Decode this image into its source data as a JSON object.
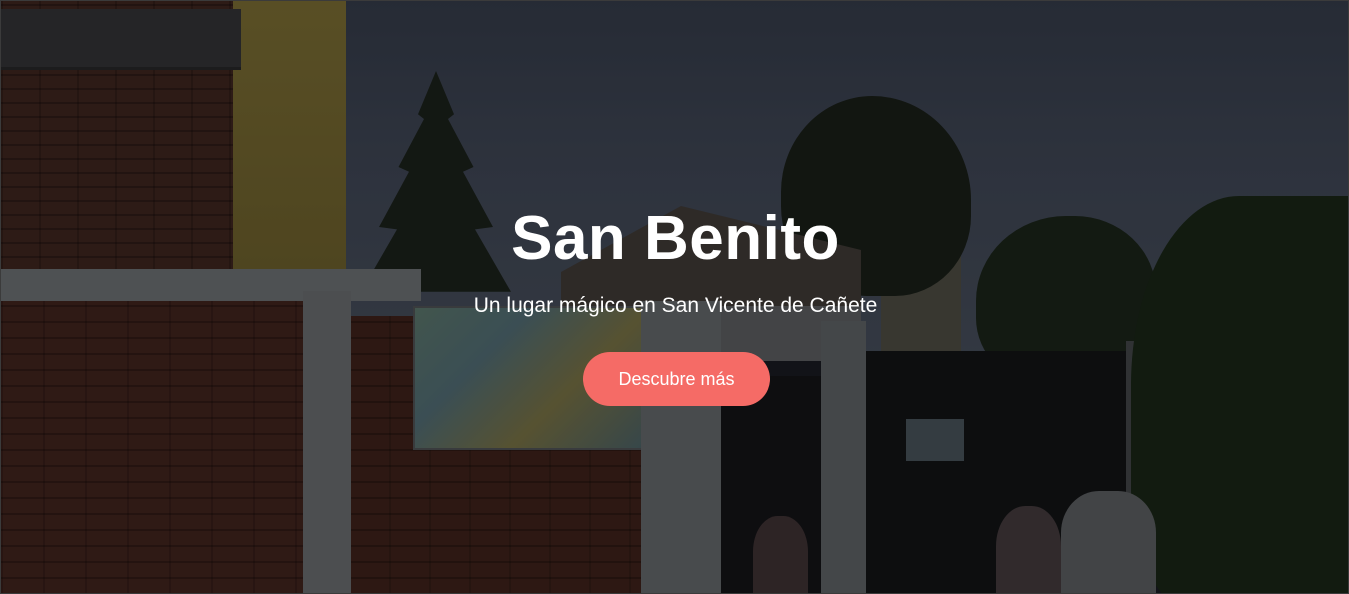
{
  "hero": {
    "title": "San Benito",
    "subtitle": "Un lugar mágico en San Vicente de Cañete",
    "cta_label": "Descubre más",
    "cta_color": "#f56b66",
    "text_color": "#ffffff",
    "background_image": "school-entrance-photo"
  }
}
